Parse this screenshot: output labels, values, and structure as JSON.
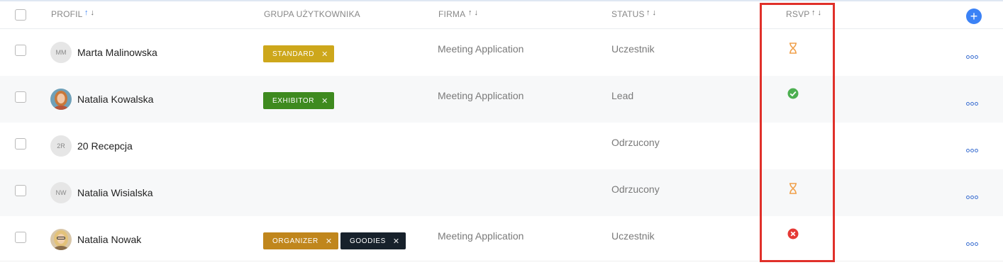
{
  "header": {
    "profile": "PROFIL",
    "group": "GRUPA UŻYTKOWNIKA",
    "company": "FIRMA",
    "status": "STATUS",
    "rsvp": "RSVP",
    "sort_up": "↑",
    "sort_down": "↓",
    "add_label": "+"
  },
  "rows": [
    {
      "initials": "MM",
      "name": "Marta Malinowska",
      "tags": [
        {
          "label": "STANDARD",
          "color": "#cda71b"
        }
      ],
      "company": "Meeting Application",
      "status": "Uczestnik",
      "rsvp": "pending"
    },
    {
      "initials": "",
      "name": "Natalia Kowalska",
      "tags": [
        {
          "label": "EXHIBITOR",
          "color": "#3e8a1f"
        }
      ],
      "company": "Meeting Application",
      "status": "Lead",
      "rsvp": "accepted"
    },
    {
      "initials": "2R",
      "name": "20 Recepcja",
      "tags": [],
      "company": "",
      "status": "Odrzucony",
      "rsvp": "none"
    },
    {
      "initials": "NW",
      "name": "Natalia Wisialska",
      "tags": [],
      "company": "",
      "status": "Odrzucony",
      "rsvp": "pending"
    },
    {
      "initials": "",
      "name": "Natalia Nowak",
      "tags": [
        {
          "label": "ORGANIZER",
          "color": "#c0861c"
        },
        {
          "label": "GOODIES",
          "color": "#17212b"
        }
      ],
      "company": "Meeting Application",
      "status": "Uczestnik",
      "rsvp": "declined"
    }
  ],
  "tag_remove": "✕",
  "colors": {
    "accent": "#3b82f6",
    "pending": "#f0a04b",
    "accepted": "#4caf50",
    "declined": "#e53935",
    "highlight": "#e0302a"
  }
}
